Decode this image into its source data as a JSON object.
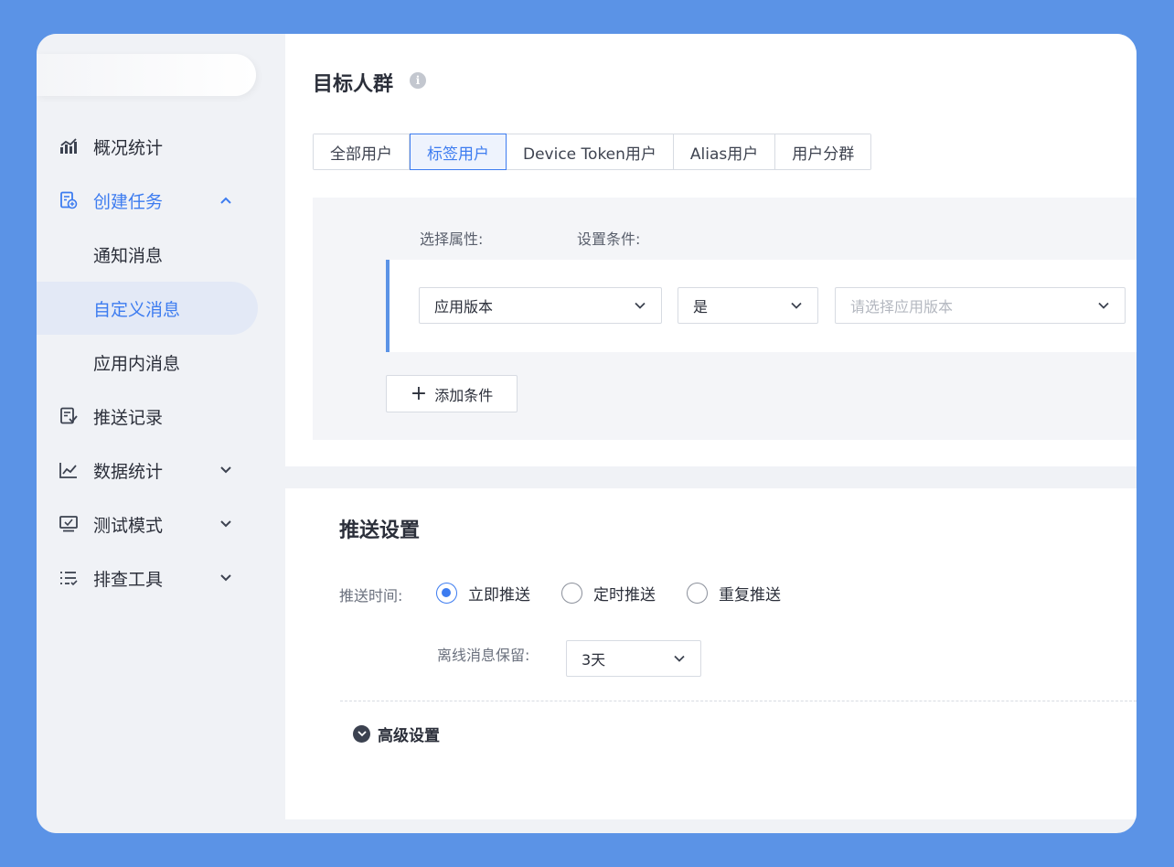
{
  "sidebar": {
    "items": [
      {
        "label": "概况统计",
        "icon": "bar-chart-icon"
      },
      {
        "label": "创建任务",
        "icon": "create-task-icon",
        "expanded": true
      },
      {
        "label": "推送记录",
        "icon": "push-record-icon"
      },
      {
        "label": "数据统计",
        "icon": "line-chart-icon"
      },
      {
        "label": "测试模式",
        "icon": "monitor-icon"
      },
      {
        "label": "排查工具",
        "icon": "list-check-icon"
      }
    ],
    "sub_items": [
      {
        "label": "通知消息"
      },
      {
        "label": "自定义消息",
        "selected": true
      },
      {
        "label": "应用内消息"
      }
    ]
  },
  "target": {
    "title": "目标人群",
    "tabs": [
      "全部用户",
      "标签用户",
      "Device Token用户",
      "Alias用户",
      "用户分群"
    ],
    "active_tab": "标签用户",
    "attr_header": "选择属性:",
    "cond_header": "设置条件:",
    "attr_value": "应用版本",
    "operator_value": "是",
    "value_placeholder": "请选择应用版本",
    "add_button": "添加条件"
  },
  "push": {
    "title": "推送设置",
    "time_label": "推送时间:",
    "options": [
      "立即推送",
      "定时推送",
      "重复推送"
    ],
    "selected_option": "立即推送",
    "offline_label": "离线消息保留:",
    "offline_value": "3天",
    "advanced": "高级设置"
  },
  "colors": {
    "accent": "#3d7cf0",
    "background": "#5b93e6",
    "sidebar": "#f0f2f6"
  }
}
